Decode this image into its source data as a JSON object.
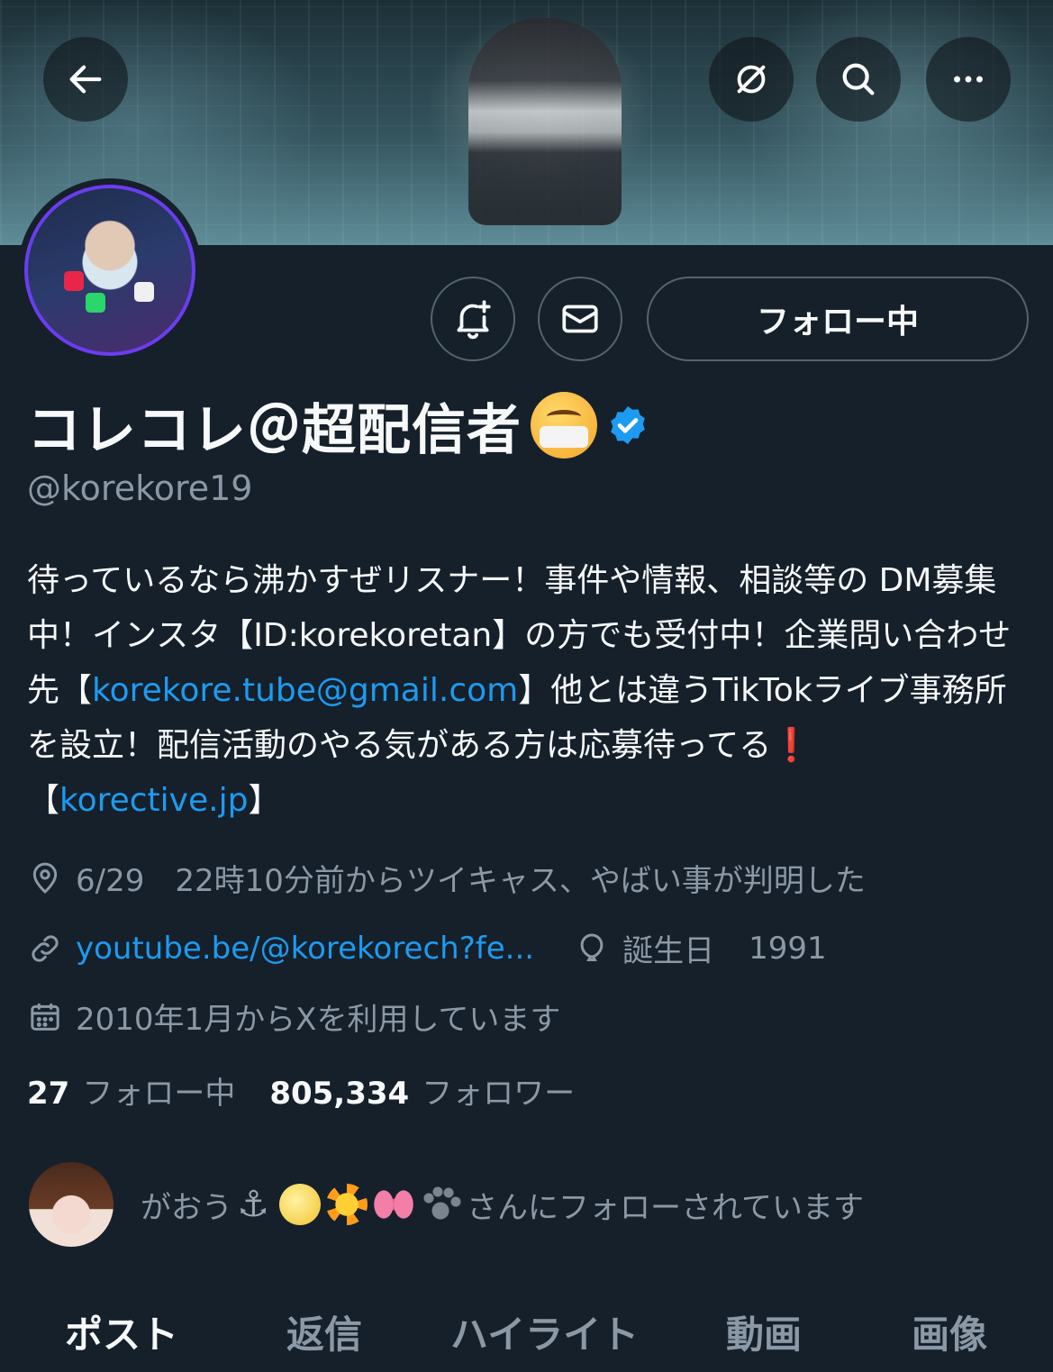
{
  "header": {
    "back_icon": "back-arrow-icon",
    "grok_icon": "slashed-circle-icon",
    "search_icon": "search-icon",
    "more_icon": "more-horizontal-icon"
  },
  "actions": {
    "notify_icon": "bell-plus-icon",
    "message_icon": "envelope-icon",
    "follow_label": "フォロー中"
  },
  "profile": {
    "name": "コレコレ＠超配信者",
    "handle": "@korekore19",
    "bio": {
      "p1": "待っているなら沸かすぜリスナー！事件や情報、相談等の DM募集中！インスタ【ID:korekoretan】の方でも受付中！企業問い合わせ先【",
      "email": "korekore.tube@gmail.com",
      "p2": "】他とは違うTikTokライブ事務所を設立！配信活動のやる気がある方は応募待ってる",
      "excl": "❗",
      "p3": "【",
      "site": "korective.jp",
      "p4": "】"
    },
    "location": "6/29　22時10分前からツイキャス、やばい事が判明した",
    "url": "youtube.be/@korekorech?fe...",
    "birthday_label": "誕生日",
    "birthday_value": "1991",
    "joined": "2010年1月からXを利用しています",
    "following_count": "27",
    "following_label": "フォロー中",
    "followers_count": "805,334",
    "followers_label": "フォロワー",
    "followed_by_name": "がおう",
    "followed_by_suffix": "さんにフォローされています"
  },
  "tabs": [
    "ポスト",
    "返信",
    "ハイライト",
    "動画",
    "画像"
  ],
  "colors": {
    "background": "#15202b",
    "link": "#1d9bf0",
    "muted": "#8b98a5",
    "verified": "#1d9bf0"
  }
}
